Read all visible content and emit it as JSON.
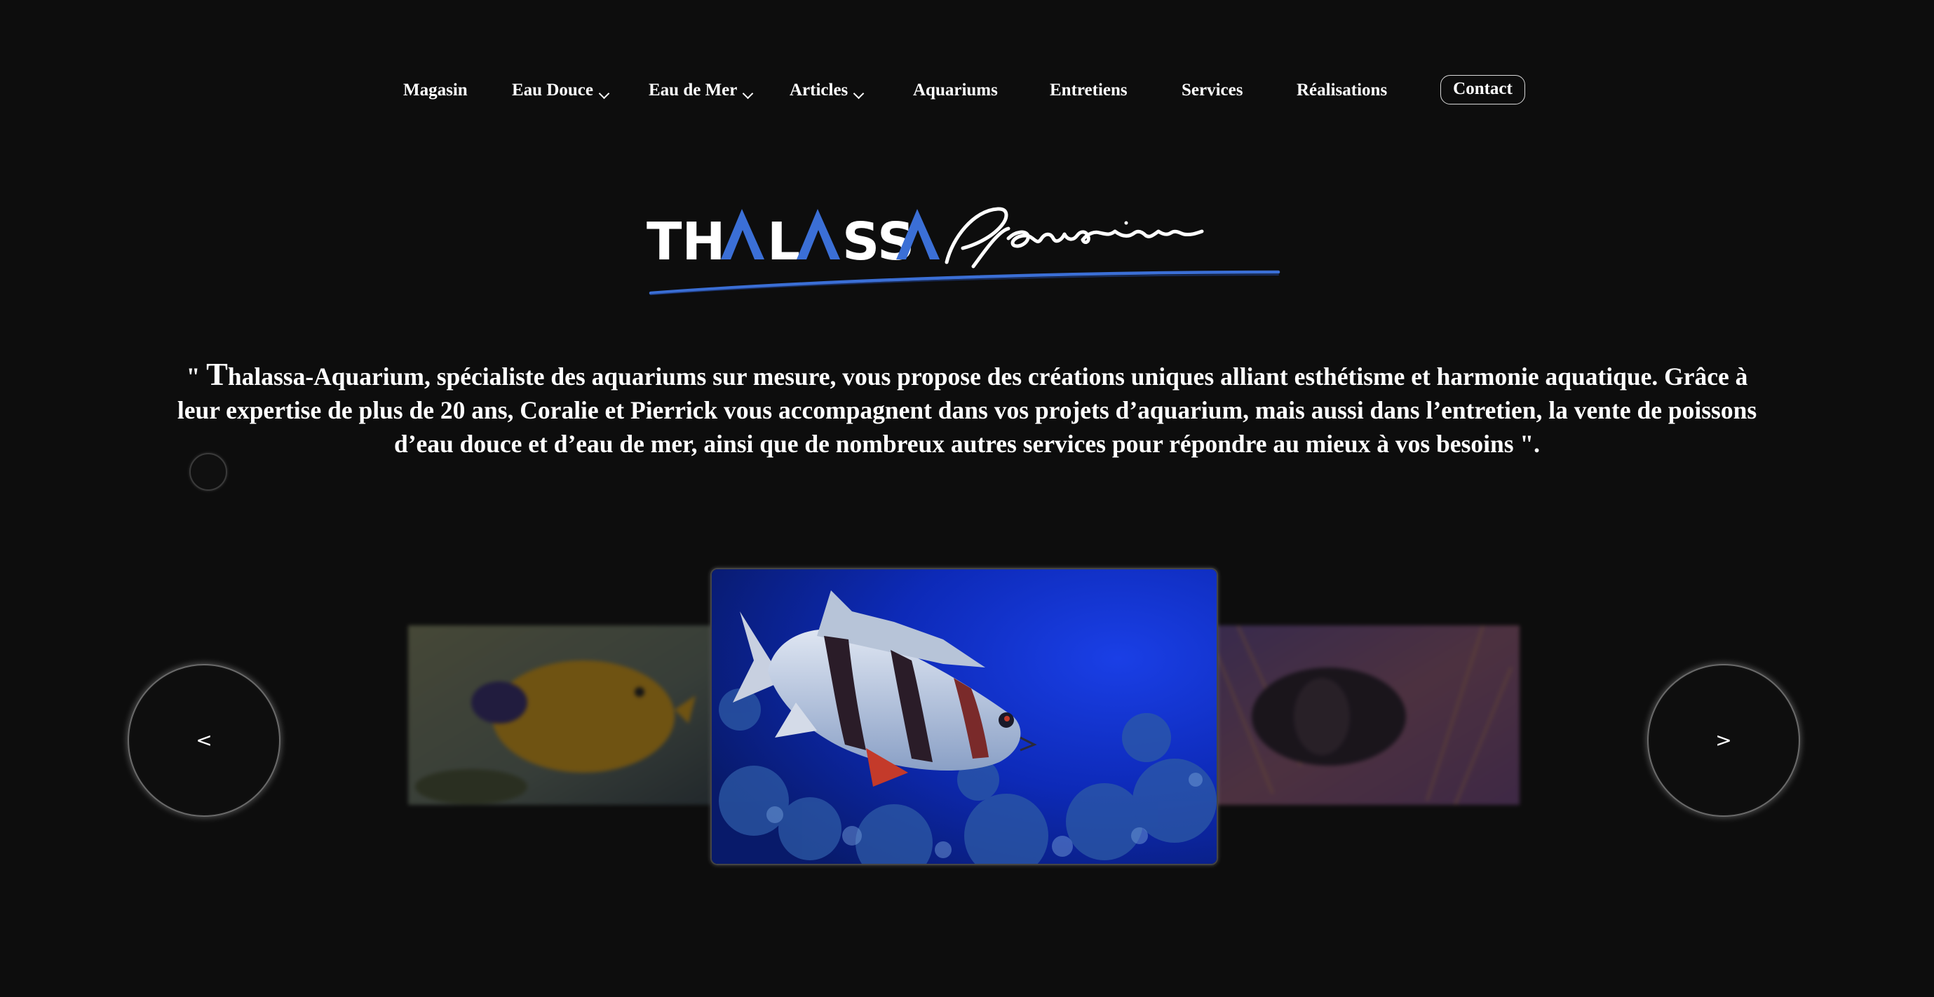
{
  "nav": {
    "items": [
      {
        "label": "Magasin",
        "dropdown": false
      },
      {
        "label": "Eau Douce",
        "dropdown": true
      },
      {
        "label": "Eau de Mer",
        "dropdown": true
      },
      {
        "label": "Articles",
        "dropdown": true
      },
      {
        "label": "Aquariums",
        "dropdown": false
      },
      {
        "label": "Entretiens",
        "dropdown": false
      },
      {
        "label": "Services",
        "dropdown": false
      },
      {
        "label": "Réalisations",
        "dropdown": false
      }
    ],
    "contact_label": "Contact"
  },
  "logo": {
    "brand": "THALASSA",
    "script": "Aquarium",
    "accent_color": "#3b6fd6"
  },
  "tagline": {
    "open_quote": "\" ",
    "dropcap": "T",
    "text": "halassa-Aquarium, spécialiste des aquariums sur mesure, vous propose des créations uniques alliant esthétisme et harmonie aquatique. Grâce à leur expertise de plus de 20 ans, Coralie et Pierrick vous accompagnent dans vos projets d’aquarium, mais aussi dans l’entretien, la vente de poissons d’eau douce et d’eau de mer, ainsi que de nombreux autres services pour répondre au mieux à vos besoins \"."
  },
  "carousel": {
    "prev_label": "<",
    "next_label": ">",
    "slides": [
      {
        "subject": "yellow tang fish",
        "position": "left"
      },
      {
        "subject": "red and white snapper fish",
        "position": "center"
      },
      {
        "subject": "clownfish in anemone",
        "position": "right"
      }
    ]
  },
  "colors": {
    "background": "#0d0d0d",
    "text": "#ffffff",
    "brand_blue": "#3b6fd6"
  }
}
